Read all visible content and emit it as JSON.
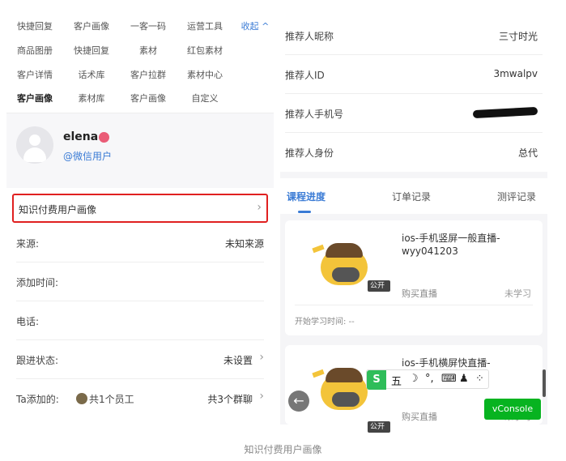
{
  "left": {
    "tools": [
      [
        "快捷回复",
        "客户画像",
        "一客一码",
        "运营工具"
      ],
      [
        "商品图册",
        "快捷回复",
        "素材",
        "红包素材"
      ],
      [
        "客户详情",
        "话术库",
        "客户拉群",
        "素材中心"
      ],
      [
        "客户画像",
        "素材库",
        "客户画像",
        "自定义"
      ]
    ],
    "collapse_label": "收起 ^",
    "profile": {
      "name": "elena",
      "source": "@微信用户"
    },
    "highlight_label": "知识付费用户画像",
    "rows": [
      {
        "key": "来源:",
        "value": "未知来源"
      },
      {
        "key": "添加时间:",
        "value": ""
      },
      {
        "key": "电话:",
        "value": ""
      },
      {
        "key": "跟进状态:",
        "value": "未设置"
      },
      {
        "key": "Ta添加的:",
        "employees": "共1个员工",
        "value": "共3个群聊"
      }
    ]
  },
  "right": {
    "info": [
      {
        "key": "推荐人昵称",
        "value": "三寸时光"
      },
      {
        "key": "推荐人ID",
        "value": "3mwalpv"
      },
      {
        "key": "推荐人手机号",
        "value": ""
      },
      {
        "key": "推荐人身份",
        "value": "总代"
      }
    ],
    "tabs": [
      "课程进度",
      "订单记录",
      "测评记录"
    ],
    "courses": [
      {
        "title": "ios-手机竖屏一般直播-wyy041203",
        "badge": "公开课",
        "buy": "购买直播",
        "status": "未学习",
        "start": "开始学习时间: --"
      },
      {
        "title": "ios-手机横屏快直播-",
        "badge": "公开课",
        "buy": "购买直播",
        "status": "未学习"
      }
    ],
    "ime": {
      "logo": "S",
      "glyphs": [
        "五",
        "☽",
        "°,",
        "⌨",
        "♟",
        "⁘"
      ]
    },
    "vconsole": "vConsole"
  },
  "caption": "知识付费用户画像",
  "colors": {
    "accent": "#3a7bd5",
    "highlight_border": "#e02020",
    "vconsole": "#07b320"
  }
}
